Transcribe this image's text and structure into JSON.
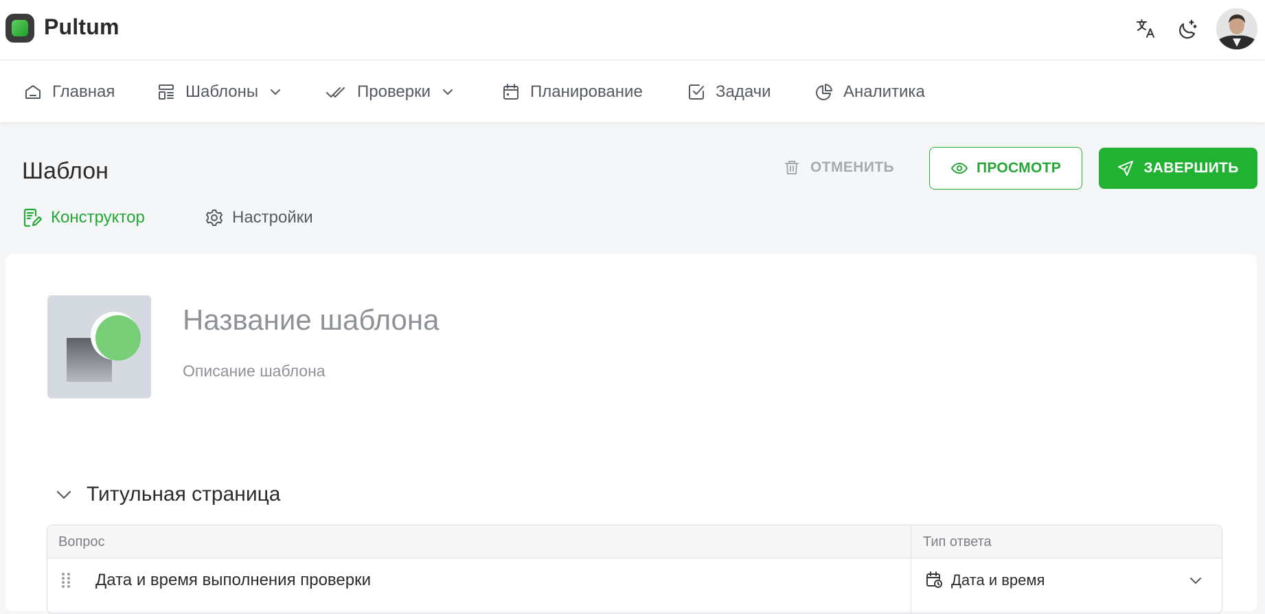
{
  "app": {
    "name": "Pultum",
    "avatar_alt": "user-avatar"
  },
  "header": {
    "translate_icon": "translate-icon",
    "theme_icon": "moon-icon"
  },
  "nav": [
    {
      "label": "Главная",
      "icon": "home-icon"
    },
    {
      "label": "Шаблоны",
      "icon": "templates-icon",
      "dropdown": true
    },
    {
      "label": "Проверки",
      "icon": "double-check-icon",
      "dropdown": true
    },
    {
      "label": "Планирование",
      "icon": "calendar-icon"
    },
    {
      "label": "Задачи",
      "icon": "checkbox-icon"
    },
    {
      "label": "Аналитика",
      "icon": "pie-chart-icon"
    }
  ],
  "page": {
    "title": "Шаблон",
    "cancel_label": "ОТМЕНИТЬ",
    "preview_label": "ПРОСМОТР",
    "finish_label": "ЗАВЕРШИТЬ",
    "tabs": [
      {
        "label": "Конструктор",
        "active": true
      },
      {
        "label": "Настройки",
        "active": false
      }
    ]
  },
  "template": {
    "name_placeholder": "Название шаблона",
    "name_value": "",
    "description_placeholder": "Описание шаблона",
    "description_value": ""
  },
  "section": {
    "title": "Титульная страница",
    "expanded": true,
    "columns": {
      "question": "Вопрос",
      "answer_type": "Тип ответа"
    },
    "rows": [
      {
        "question": "Дата и время выполнения проверки",
        "answer_type": "Дата и время",
        "answer_icon": "calendar-clock-icon"
      }
    ]
  },
  "colors": {
    "accent": "#22b233",
    "accent_text": "#27a637",
    "muted": "#a6a9ae",
    "nav_text": "#555a60",
    "background": "#f5f6f8"
  }
}
